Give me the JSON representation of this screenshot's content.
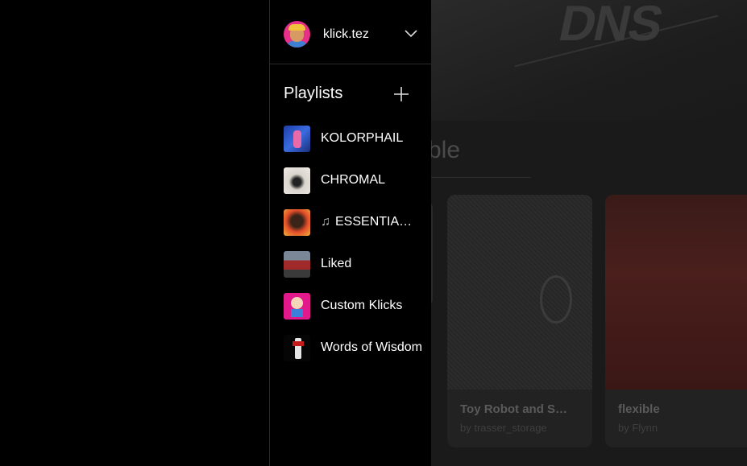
{
  "account": {
    "username": "klick.tez"
  },
  "playlists": {
    "heading": "Playlists",
    "items": [
      {
        "label": "KOLORPHAIL",
        "icon": ""
      },
      {
        "label": "CHROMAL",
        "icon": ""
      },
      {
        "label": "ESSENTIA…",
        "icon": "♫"
      },
      {
        "label": "Liked",
        "icon": ""
      },
      {
        "label": "Custom Klicks",
        "icon": ""
      },
      {
        "label": "Words of Wisdom",
        "icon": ""
      }
    ]
  },
  "background_page": {
    "hero_logo": "DNS",
    "section_title_partial": "ble",
    "cards": [
      {
        "title": "Toy Robot and S…",
        "subtitle": "by trasser_storage"
      },
      {
        "title": "flexible",
        "subtitle": "by Flynn"
      }
    ]
  },
  "colors": {
    "drawer_bg": "#000000",
    "divider": "#2a2a2a",
    "avatar_bg": "#e8308a"
  }
}
